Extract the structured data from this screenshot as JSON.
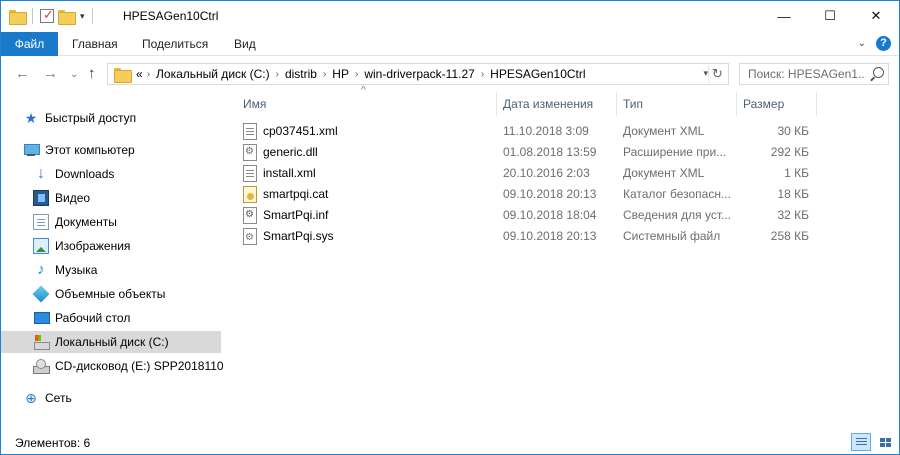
{
  "window": {
    "title": "HPESAGen10Ctrl",
    "minimize_glyph": "—",
    "maximize_glyph": "☐",
    "close_glyph": "✕"
  },
  "ribbon": {
    "tabs": [
      {
        "label": "Файл"
      },
      {
        "label": "Главная"
      },
      {
        "label": "Поделиться"
      },
      {
        "label": "Вид"
      }
    ],
    "expand_glyph": "⌄",
    "help_glyph": "?"
  },
  "address": {
    "overflow": "«",
    "crumbs": [
      "Локальный диск (C:)",
      "distrib",
      "HP",
      "win-driverpack-11.27",
      "HPESAGen10Ctrl"
    ],
    "separator": "›"
  },
  "search": {
    "placeholder": "Поиск: HPESAGen1..."
  },
  "nav_buttons": {
    "back": "←",
    "forward": "→",
    "recent": "⌄",
    "up": "↑"
  },
  "navpane": {
    "items": [
      {
        "label": "Быстрый доступ",
        "icon": "star-icon"
      },
      {
        "label": "Этот компьютер",
        "icon": "computer-icon"
      },
      {
        "label": "Downloads",
        "icon": "download-icon"
      },
      {
        "label": "Видео",
        "icon": "video-icon"
      },
      {
        "label": "Документы",
        "icon": "documents-icon"
      },
      {
        "label": "Изображения",
        "icon": "pictures-icon"
      },
      {
        "label": "Музыка",
        "icon": "music-icon"
      },
      {
        "label": "Объемные объекты",
        "icon": "3d-objects-icon"
      },
      {
        "label": "Рабочий стол",
        "icon": "desktop-icon"
      },
      {
        "label": "Локальный диск (C:)",
        "icon": "local-disk-icon"
      },
      {
        "label": "CD-дисковод (E:) SPP2018110",
        "icon": "cd-drive-icon"
      },
      {
        "label": "Сеть",
        "icon": "network-icon"
      }
    ]
  },
  "filelist": {
    "columns": [
      "Имя",
      "Дата изменения",
      "Тип",
      "Размер"
    ],
    "sort_glyph": "^",
    "rows": [
      {
        "name": "cp037451.xml",
        "date": "11.10.2018 3:09",
        "type": "Документ XML",
        "size": "30 КБ",
        "icon": "xml-file-icon"
      },
      {
        "name": "generic.dll",
        "date": "01.08.2018 13:59",
        "type": "Расширение при...",
        "size": "292 КБ",
        "icon": "dll-file-icon"
      },
      {
        "name": "install.xml",
        "date": "20.10.2016 2:03",
        "type": "Документ XML",
        "size": "1 КБ",
        "icon": "xml-file-icon"
      },
      {
        "name": "smartpqi.cat",
        "date": "09.10.2018 20:13",
        "type": "Каталог безопасн...",
        "size": "18 КБ",
        "icon": "cat-file-icon"
      },
      {
        "name": "SmartPqi.inf",
        "date": "09.10.2018 18:04",
        "type": "Сведения для уст...",
        "size": "32 КБ",
        "icon": "inf-file-icon"
      },
      {
        "name": "SmartPqi.sys",
        "date": "09.10.2018 20:13",
        "type": "Системный файл",
        "size": "258 КБ",
        "icon": "sys-file-icon"
      }
    ]
  },
  "status": {
    "items_count": "Элементов: 6"
  },
  "colors": {
    "accent": "#1979ca",
    "selection": "#cce8ff",
    "header_text": "#4c607a"
  }
}
